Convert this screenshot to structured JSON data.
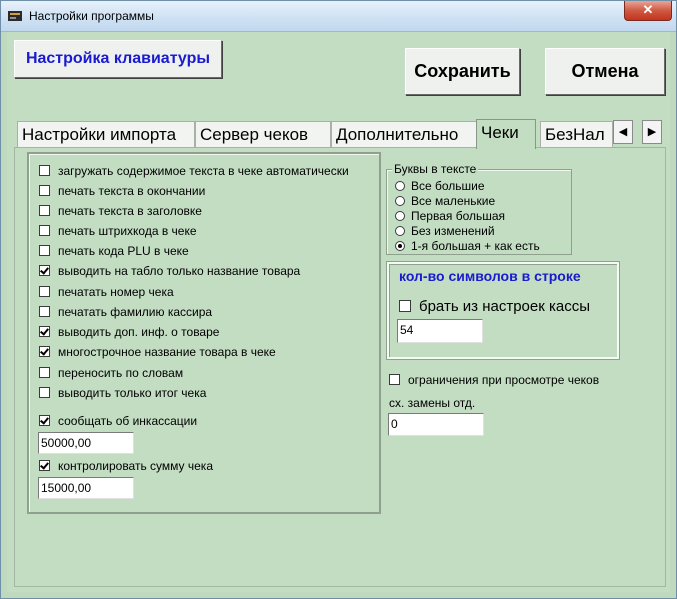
{
  "window": {
    "title": "Настройки программы",
    "close_label": "✕"
  },
  "buttons": {
    "keyboard": "Настройка клавиатуры",
    "save": "Сохранить",
    "cancel": "Отмена"
  },
  "tabs": [
    "Настройки импорта",
    "Сервер чеков",
    "Дополнительно",
    "Чеки",
    "БезНал"
  ],
  "active_tab": "Чеки",
  "tab_scroll": {
    "left": "◀",
    "right": "▶"
  },
  "receipt_options": [
    {
      "label": "загружать содержимое текста в чеке автоматически",
      "checked": false
    },
    {
      "label": "печать текста в окончании",
      "checked": false
    },
    {
      "label": "печать текста в заголовке",
      "checked": false
    },
    {
      "label": "печать штрихкода в чеке",
      "checked": false
    },
    {
      "label": "печать кода PLU в чеке",
      "checked": false
    },
    {
      "label": "выводить на табло только название товара",
      "checked": true
    },
    {
      "label": "печатать номер чека",
      "checked": false
    },
    {
      "label": "печатать фамилию кассира",
      "checked": false
    },
    {
      "label": "выводить доп. инф. о товаре",
      "checked": true
    },
    {
      "label": "многострочное название товара в чеке",
      "checked": true
    },
    {
      "label": "переносить по словам",
      "checked": false
    },
    {
      "label": "выводить только итог чека",
      "checked": false
    }
  ],
  "encashment": {
    "label": "сообщать об инкассации",
    "checked": true,
    "value": "50000,00"
  },
  "receipt_sum": {
    "label": "контролировать сумму чека",
    "checked": true,
    "value": "15000,00"
  },
  "letters": {
    "title": "Буквы в тексте",
    "options": [
      "Все большие",
      "Все маленькие",
      "Первая большая",
      "Без изменений",
      "1-я большая + как есть"
    ],
    "selected_index": 4
  },
  "symbols": {
    "title": "кол-во символов в строке",
    "from_settings_label": "брать из настроек кассы",
    "from_settings_checked": false,
    "value": "54"
  },
  "view_restrictions": {
    "label": "ограничения при просмотре чеков",
    "checked": false
  },
  "replacement": {
    "label": "сх. замены отд.",
    "value": "0"
  }
}
